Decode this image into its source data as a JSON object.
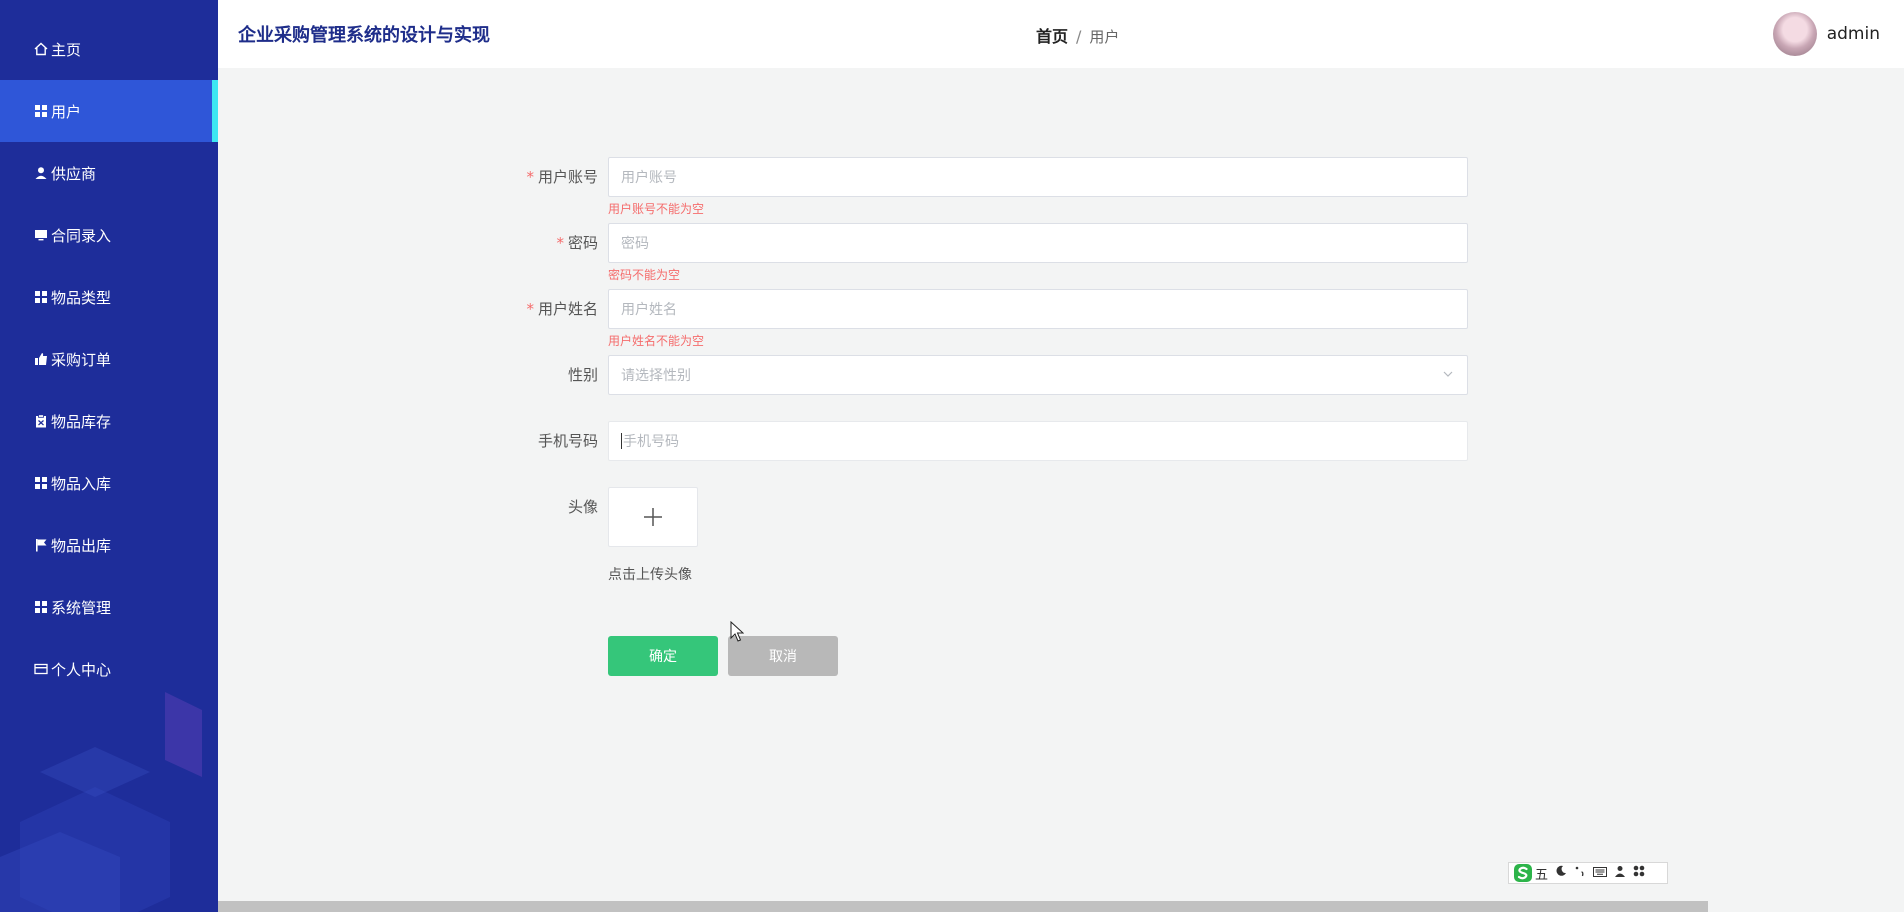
{
  "app": {
    "title": "企业采购管理系统的设计与实现"
  },
  "sidebar": {
    "items": [
      {
        "label": "主页",
        "icon": "home-icon"
      },
      {
        "label": "用户",
        "icon": "grid-icon",
        "active": true
      },
      {
        "label": "供应商",
        "icon": "person-icon"
      },
      {
        "label": "合同录入",
        "icon": "monitor-icon"
      },
      {
        "label": "物品类型",
        "icon": "grid-icon"
      },
      {
        "label": "采购订单",
        "icon": "thumbs-up-icon"
      },
      {
        "label": "物品库存",
        "icon": "clipboard-icon"
      },
      {
        "label": "物品入库",
        "icon": "grid-icon"
      },
      {
        "label": "物品出库",
        "icon": "flag-icon"
      },
      {
        "label": "系统管理",
        "icon": "grid-icon"
      },
      {
        "label": "个人中心",
        "icon": "card-icon"
      }
    ]
  },
  "breadcrumb": {
    "home": "首页",
    "separator": "/",
    "current": "用户"
  },
  "user": {
    "name": "admin"
  },
  "form": {
    "account": {
      "label": "用户账号",
      "placeholder": "用户账号",
      "error": "用户账号不能为空"
    },
    "password": {
      "label": "密码",
      "placeholder": "密码",
      "error": "密码不能为空"
    },
    "name": {
      "label": "用户姓名",
      "placeholder": "用户姓名",
      "error": "用户姓名不能为空"
    },
    "gender": {
      "label": "性别",
      "placeholder": "请选择性别"
    },
    "phone": {
      "label": "手机号码",
      "placeholder": "手机号码"
    },
    "avatar": {
      "label": "头像",
      "hint": "点击上传头像"
    },
    "required_mark": "*"
  },
  "buttons": {
    "confirm": "确定",
    "cancel": "取消"
  },
  "ime": {
    "mode": "五"
  },
  "colors": {
    "sidebar": "#1e2d9a",
    "active_item": "#2f56d8",
    "active_bar": "#3ee7f2",
    "confirm": "#35c67a",
    "error": "#f56c6c"
  }
}
